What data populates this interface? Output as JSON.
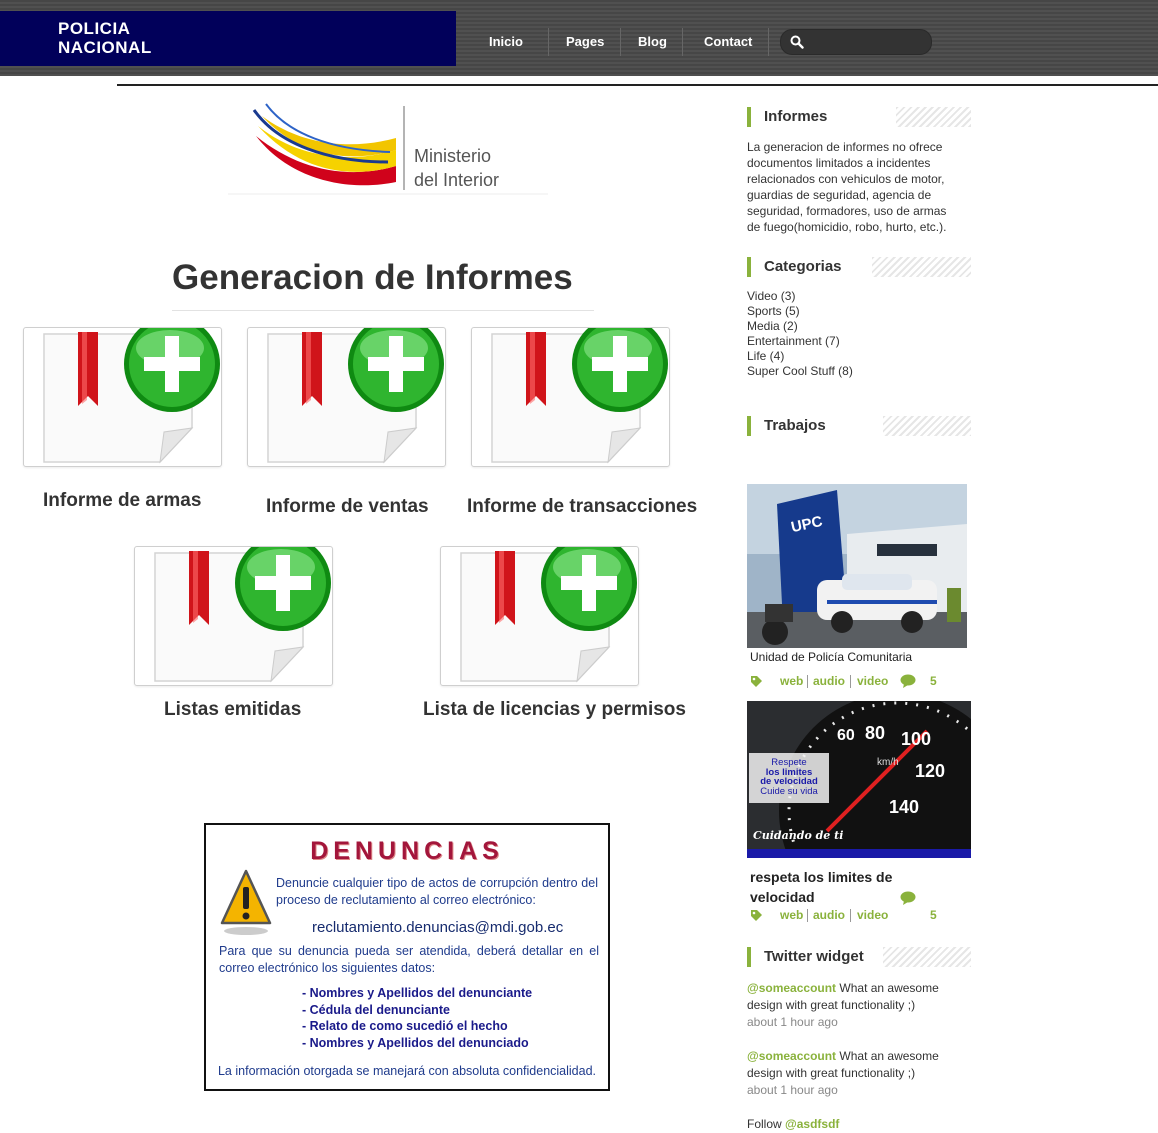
{
  "header": {
    "brand_line1": "POLICIA",
    "brand_line2": "NACIONAL",
    "nav": [
      "Inicio",
      "Pages",
      "Blog",
      "Contact"
    ],
    "search_placeholder": ""
  },
  "main": {
    "ministry_line1": "Ministerio",
    "ministry_line2": "del Interior",
    "title": "Generacion de Informes",
    "tiles": [
      {
        "label": "Informe de armas"
      },
      {
        "label": "Informe de ventas"
      },
      {
        "label": "Informe de transacciones"
      },
      {
        "label": "Listas emitidas"
      },
      {
        "label": "Lista de licencias y permisos"
      }
    ],
    "denuncias": {
      "title": "DENUNCIAS",
      "p1": "Denuncie cualquier tipo de actos de corrupción dentro del proceso de reclutamiento al correo electrónico:",
      "email": "reclutamiento.denuncias@mdi.gob.ec",
      "p2": "Para que su denuncia pueda ser atendida, deberá detallar en el correo electrónico los siguientes datos:",
      "items": [
        "- Nombres y Apellidos del denunciante",
        "- Cédula del denunciante",
        "- Relato de como sucedió el hecho",
        "- Nombres y Apellidos del denunciado"
      ],
      "footer": "La información otorgada se manejará con absoluta confidencialidad."
    }
  },
  "sidebar": {
    "informes": {
      "heading": "Informes",
      "text": "La generacion de informes no ofrece documentos limitados a incidentes relacionados con vehiculos de motor, guardias de seguridad, agencia de seguridad, formadores, uso de armas de fuego(homicidio, robo, hurto, etc.)."
    },
    "categorias": {
      "heading": "Categorias",
      "items": [
        "Video (3)",
        "Sports (5)",
        "Media (2)",
        "Entertainment (7)",
        "Life (4)",
        "Super Cool Stuff (8)"
      ]
    },
    "trabajos": {
      "heading": "Trabajos",
      "posts": [
        {
          "title": "Unidad de Policía Comunitaria",
          "tags": [
            "web",
            "audio",
            "video"
          ],
          "comments": "5",
          "image_text": "UPC"
        },
        {
          "title": "respeta los limites de velocidad",
          "tags": [
            "web",
            "audio",
            "video"
          ],
          "comments": "5",
          "image_lines": [
            "Respete",
            "los limites",
            "de velocidad",
            "Cuide su vida"
          ],
          "image_caption": "Cuidando de ti",
          "gauge_numbers": [
            "60",
            "80",
            "100",
            "120",
            "140"
          ],
          "gauge_unit": "km/h"
        }
      ]
    },
    "twitter": {
      "heading": "Twitter widget",
      "tweets": [
        {
          "user": "@someaccount",
          "text": " What an awesome design with great functionality ;)",
          "time": "about 1 hour ago"
        },
        {
          "user": "@someaccount",
          "text": " What an awesome design with great functionality ;)",
          "time": "about 1 hour ago"
        }
      ],
      "follow_prefix": "Follow ",
      "follow_user": "@asdfsdf"
    }
  },
  "colors": {
    "brand_bg": "#01005a",
    "accent_green": "#8ab23c",
    "denuncias_title": "#a3163b"
  },
  "icons": [
    "search-icon",
    "tag-icon",
    "comment-icon",
    "warning-icon",
    "add-report-icon"
  ]
}
